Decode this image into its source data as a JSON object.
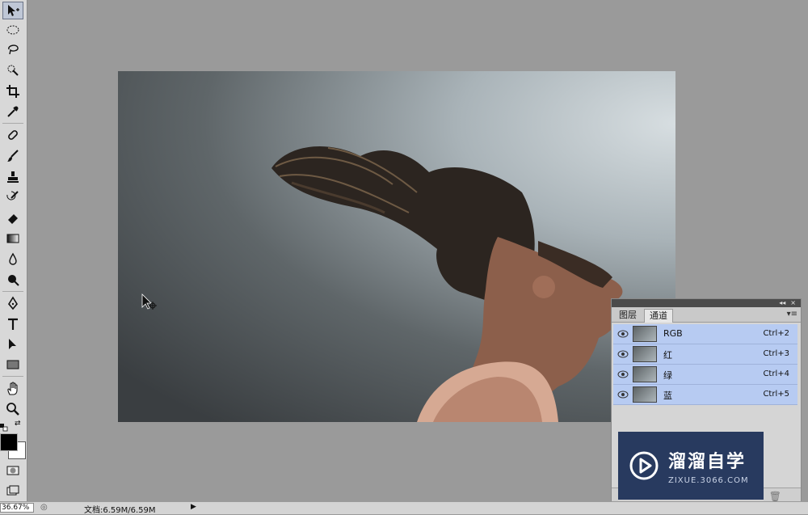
{
  "tools": [
    {
      "name": "move-tool-icon",
      "active": true
    },
    {
      "name": "marquee-tool-icon"
    },
    {
      "name": "lasso-tool-icon"
    },
    {
      "name": "quick-selection-tool-icon"
    },
    {
      "name": "crop-tool-icon"
    },
    {
      "name": "eyedropper-tool-icon"
    },
    {
      "name": "healing-brush-tool-icon"
    },
    {
      "name": "brush-tool-icon"
    },
    {
      "name": "clone-stamp-tool-icon"
    },
    {
      "name": "history-brush-tool-icon"
    },
    {
      "name": "eraser-tool-icon"
    },
    {
      "name": "gradient-tool-icon"
    },
    {
      "name": "blur-tool-icon"
    },
    {
      "name": "dodge-tool-icon"
    },
    {
      "name": "pen-tool-icon"
    },
    {
      "name": "type-tool-icon"
    },
    {
      "name": "path-selection-tool-icon"
    },
    {
      "name": "rectangle-tool-icon"
    },
    {
      "name": "hand-tool-icon"
    },
    {
      "name": "zoom-tool-icon"
    }
  ],
  "panel": {
    "tabs": [
      "图层",
      "通道"
    ],
    "active_tab": "通道",
    "channels": [
      {
        "name": "RGB",
        "shortcut": "Ctrl+2"
      },
      {
        "name": "红",
        "shortcut": "Ctrl+3"
      },
      {
        "name": "绿",
        "shortcut": "Ctrl+4"
      },
      {
        "name": "蓝",
        "shortcut": "Ctrl+5"
      }
    ]
  },
  "status": {
    "zoom": "36.67%",
    "doc_info": "文档:6.59M/6.59M"
  },
  "watermark": {
    "name": "溜溜自学",
    "url": "ZIXUE.3066.COM"
  },
  "colors": {
    "selection_row": "#b7cbf2",
    "workspace": "#9a9a9a",
    "watermark_bg": "#283a5f"
  }
}
